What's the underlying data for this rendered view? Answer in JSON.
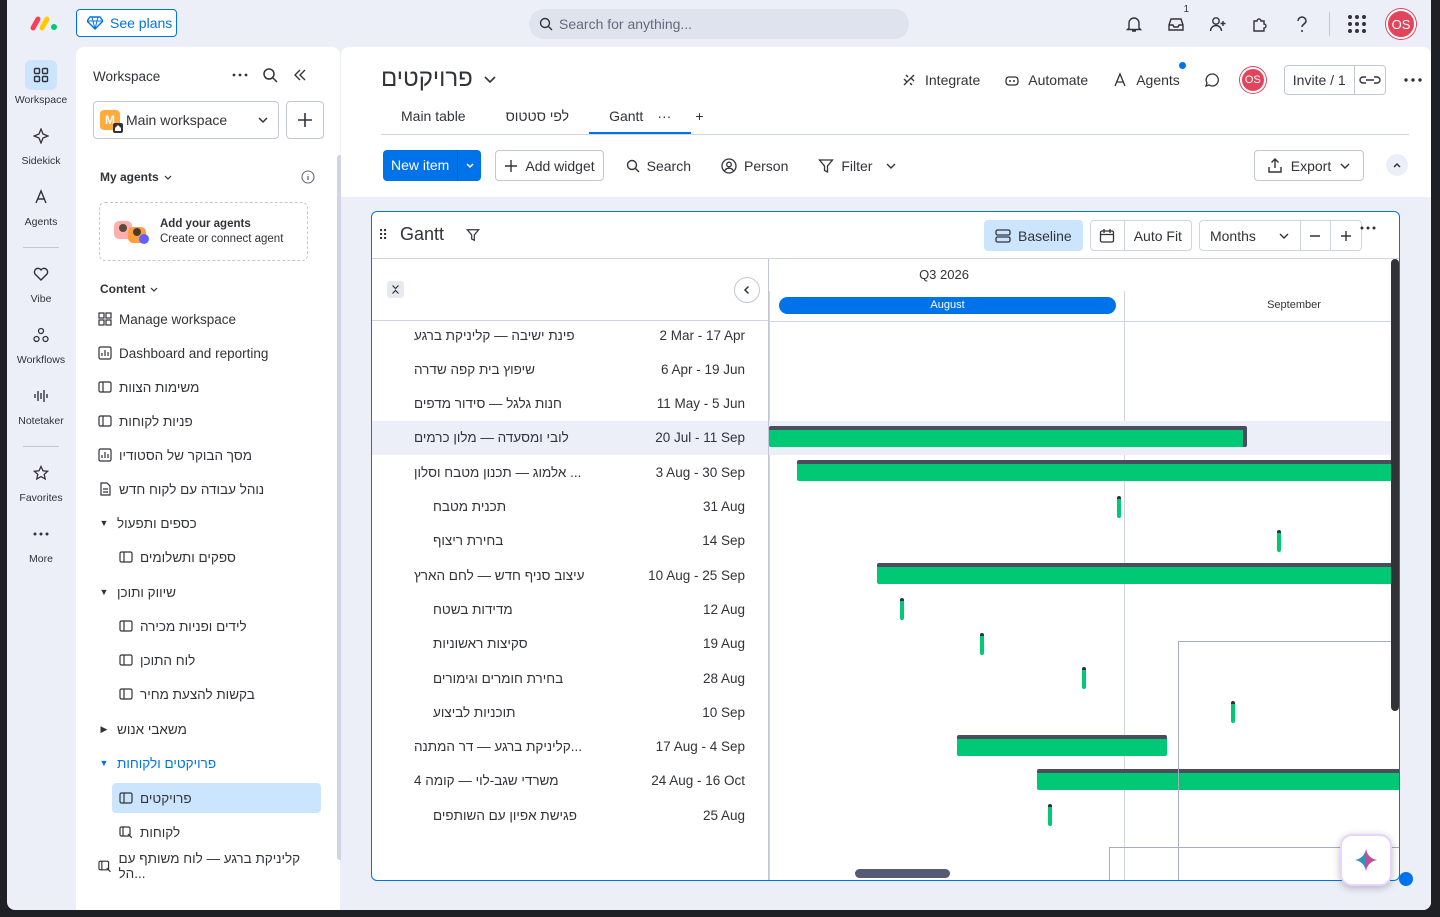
{
  "topbar": {
    "see_plans": "See plans",
    "search_placeholder": "Search for anything...",
    "inbox_badge": "1",
    "avatar": "OS"
  },
  "rail": {
    "items": [
      {
        "label": "Workspace",
        "icon": "grid-icon"
      },
      {
        "label": "Sidekick",
        "icon": "sparkle-icon"
      },
      {
        "label": "Agents",
        "icon": "agent-icon"
      },
      {
        "label": "Vibe",
        "icon": "heart-icon"
      },
      {
        "label": "Workflows",
        "icon": "workflow-icon"
      },
      {
        "label": "Notetaker",
        "icon": "waveform-icon"
      },
      {
        "label": "Favorites",
        "icon": "star-icon"
      },
      {
        "label": "More",
        "icon": "more-icon"
      }
    ]
  },
  "workspace_panel": {
    "title": "Workspace",
    "selected_workspace": "Main workspace",
    "workspace_initial": "M",
    "my_agents_label": "My agents",
    "agent_card_title": "Add your agents",
    "agent_card_subtitle": "Create or connect agent",
    "content_label": "Content",
    "nav": [
      {
        "label": "Manage workspace",
        "icon": "workspace-icon",
        "indent": 0
      },
      {
        "label": "Dashboard and reporting",
        "icon": "dashboard-icon",
        "indent": 0
      },
      {
        "label": "משימות הצוות",
        "icon": "board-icon",
        "indent": 0
      },
      {
        "label": "פניות לקוחות",
        "icon": "board-icon",
        "indent": 0
      },
      {
        "label": "מסך הבוקר של הסטודיו",
        "icon": "dashboard-icon",
        "indent": 0
      },
      {
        "label": "נוהל עבודה עם לקוח חדש",
        "icon": "doc-icon",
        "indent": 0
      },
      {
        "label": "כספים ותפעול",
        "icon": "folder-open",
        "indent": 0
      },
      {
        "label": "ספקים ותשלומים",
        "icon": "board-icon",
        "indent": 1
      },
      {
        "label": "שיווק ותוכן",
        "icon": "folder-open",
        "indent": 0
      },
      {
        "label": "לידים ופניות מכירה",
        "icon": "board-icon",
        "indent": 1
      },
      {
        "label": "לוח התוכן",
        "icon": "board-icon",
        "indent": 1
      },
      {
        "label": "בקשות להצעת מחיר",
        "icon": "board-icon",
        "indent": 1
      },
      {
        "label": "משאבי אנוש",
        "icon": "folder-closed",
        "indent": 0
      },
      {
        "label": "פרויקטים ולקוחות",
        "icon": "folder-open-blue",
        "indent": 0
      },
      {
        "label": "פרויקטים",
        "icon": "board-icon",
        "indent": 1,
        "selected": true
      },
      {
        "label": "לקוחות",
        "icon": "board-link-icon",
        "indent": 1
      },
      {
        "label": "קליניקת ברגע — לוח משותף עם הל...",
        "icon": "board-link-icon",
        "indent": 0
      }
    ]
  },
  "board": {
    "title": "פרויקטים",
    "actions": {
      "integrate": "Integrate",
      "automate": "Automate",
      "agents": "Agents",
      "invite": "Invite / 1",
      "avatar": "OS"
    },
    "tabs": [
      "Main table",
      "לפי סטטוס",
      "Gantt"
    ],
    "toolbar": {
      "new_item": "New item",
      "add_widget": "Add widget",
      "search": "Search",
      "person": "Person",
      "filter": "Filter",
      "export": "Export"
    }
  },
  "gantt": {
    "title": "Gantt",
    "baseline": "Baseline",
    "auto_fit": "Auto Fit",
    "scale": "Months",
    "quarter": "Q3 2026",
    "months": [
      "August",
      "September"
    ],
    "rows": [
      {
        "name": "פינת ישיבה — קליניקת ברגע",
        "dates": "2 Mar - 17 Apr",
        "sub": false
      },
      {
        "name": "שיפוץ בית קפה שדרה",
        "dates": "6 Apr - 19 Jun",
        "sub": false
      },
      {
        "name": "חנות גלגל — סידור מדפים",
        "dates": "11 May - 5 Jun",
        "sub": false
      },
      {
        "name": "לובי ומסעדה — מלון כרמים",
        "dates": "20 Jul - 11 Sep",
        "sub": false,
        "highlight": true
      },
      {
        "name": "אלמוג — תכנון מטבח וסלון ...",
        "dates": "3 Aug - 30 Sep",
        "sub": false
      },
      {
        "name": "תכנית מטבח",
        "dates": "31 Aug",
        "sub": true
      },
      {
        "name": "בחירת ריצוף",
        "dates": "14 Sep",
        "sub": true
      },
      {
        "name": "עיצוב סניף חדש — לחם הארץ",
        "dates": "10 Aug - 25 Sep",
        "sub": false
      },
      {
        "name": "מדידות בשטח",
        "dates": "12 Aug",
        "sub": true
      },
      {
        "name": "סקיצות ראשוניות",
        "dates": "19 Aug",
        "sub": true
      },
      {
        "name": "בחירת חומרים וגימורים",
        "dates": "28 Aug",
        "sub": true
      },
      {
        "name": "תוכניות לביצוע",
        "dates": "10 Sep",
        "sub": true
      },
      {
        "name": "קליניקת ברגע — דר המתנה...",
        "dates": "17 Aug - 4 Sep",
        "sub": false
      },
      {
        "name": "משרדי שגב-לוי — קומה 4",
        "dates": "24 Aug - 16 Oct",
        "sub": false
      },
      {
        "name": "פגישת אפיון עם השותפים",
        "dates": "25 Aug",
        "sub": true
      }
    ]
  },
  "colors": {
    "accent": "#0073ea",
    "bar": "#00c875",
    "avatar": "#e2445c"
  }
}
